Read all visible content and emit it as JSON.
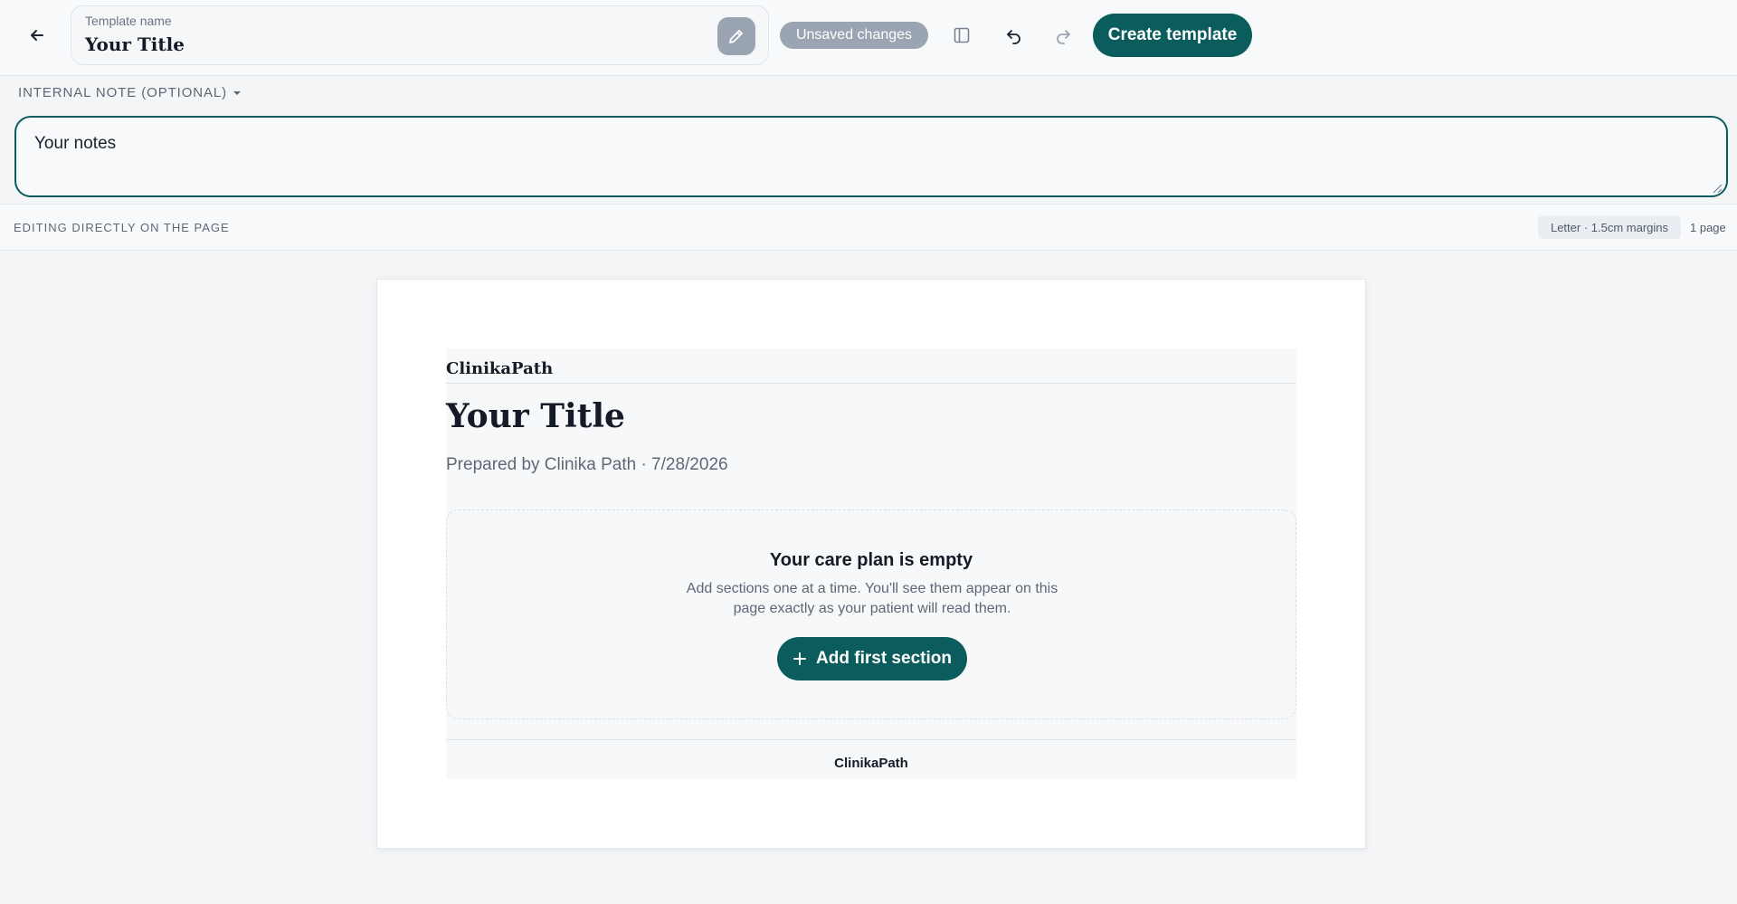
{
  "header": {
    "template_name_label": "Template name",
    "template_name_value": "Your Title",
    "unsaved_badge": "Unsaved changes",
    "create_button": "Create template",
    "icons": {
      "back": "arrow-left-icon",
      "edit": "pencil-icon",
      "panel": "sidebar-panel-icon",
      "undo": "undo-icon",
      "redo": "redo-icon"
    }
  },
  "note": {
    "toggle_label": "INTERNAL NOTE (OPTIONAL)",
    "value": "Your notes"
  },
  "status": {
    "mode_label": "EDITING DIRECTLY ON THE PAGE",
    "page_format": "Letter · 1.5cm margins",
    "page_count": "1 page"
  },
  "document": {
    "brand": "ClinikaPath",
    "title": "Your Title",
    "subtitle": "Prepared by Clinika Path · 7/28/2026",
    "empty_title": "Your care plan is empty",
    "empty_description": "Add sections one at a time. You'll see them appear on this page exactly as your patient will read them.",
    "add_section_button": "Add first section",
    "footer_brand": "ClinikaPath"
  },
  "colors": {
    "accent": "#0b5c5c",
    "badge": "#9aa4b3",
    "background": "#f3f5f7"
  }
}
